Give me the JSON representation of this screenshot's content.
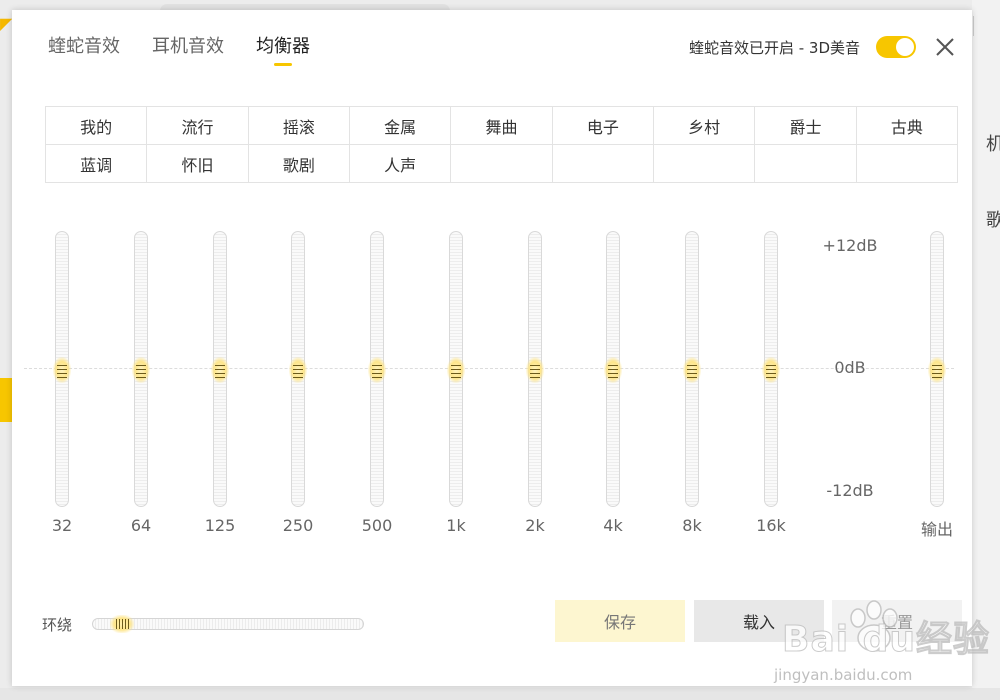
{
  "background": {
    "right_chars": [
      "机",
      "歌"
    ]
  },
  "tabs": [
    {
      "label": "蝰蛇音效",
      "active": false
    },
    {
      "label": "耳机音效",
      "active": false
    },
    {
      "label": "均衡器",
      "active": true
    }
  ],
  "status": {
    "text": "蝰蛇音效已开启 - 3D美音",
    "toggle_on": true
  },
  "presets": [
    "我的",
    "流行",
    "摇滚",
    "金属",
    "舞曲",
    "电子",
    "乡村",
    "爵士",
    "古典",
    "蓝调",
    "怀旧",
    "歌剧",
    "人声",
    "",
    "",
    "",
    "",
    ""
  ],
  "equalizer": {
    "bands": [
      {
        "label": "32",
        "gain_db": 0
      },
      {
        "label": "64",
        "gain_db": 0
      },
      {
        "label": "125",
        "gain_db": 0
      },
      {
        "label": "250",
        "gain_db": 0
      },
      {
        "label": "500",
        "gain_db": 0
      },
      {
        "label": "1k",
        "gain_db": 0
      },
      {
        "label": "2k",
        "gain_db": 0
      },
      {
        "label": "4k",
        "gain_db": 0
      },
      {
        "label": "8k",
        "gain_db": 0
      },
      {
        "label": "16k",
        "gain_db": 0
      }
    ],
    "output": {
      "label": "输出",
      "gain_db": 0
    },
    "scale": {
      "max": "+12dB",
      "mid": "0dB",
      "min": "-12dB"
    },
    "range_db": [
      -12,
      12
    ]
  },
  "surround": {
    "label": "环绕",
    "value": 0.07
  },
  "buttons": {
    "save": "保存",
    "load": "载入",
    "reset": "重置"
  },
  "watermark": {
    "brand": "Bai du经验",
    "url": "jingyan.baidu.com"
  },
  "colors": {
    "accent": "#f7c600"
  }
}
